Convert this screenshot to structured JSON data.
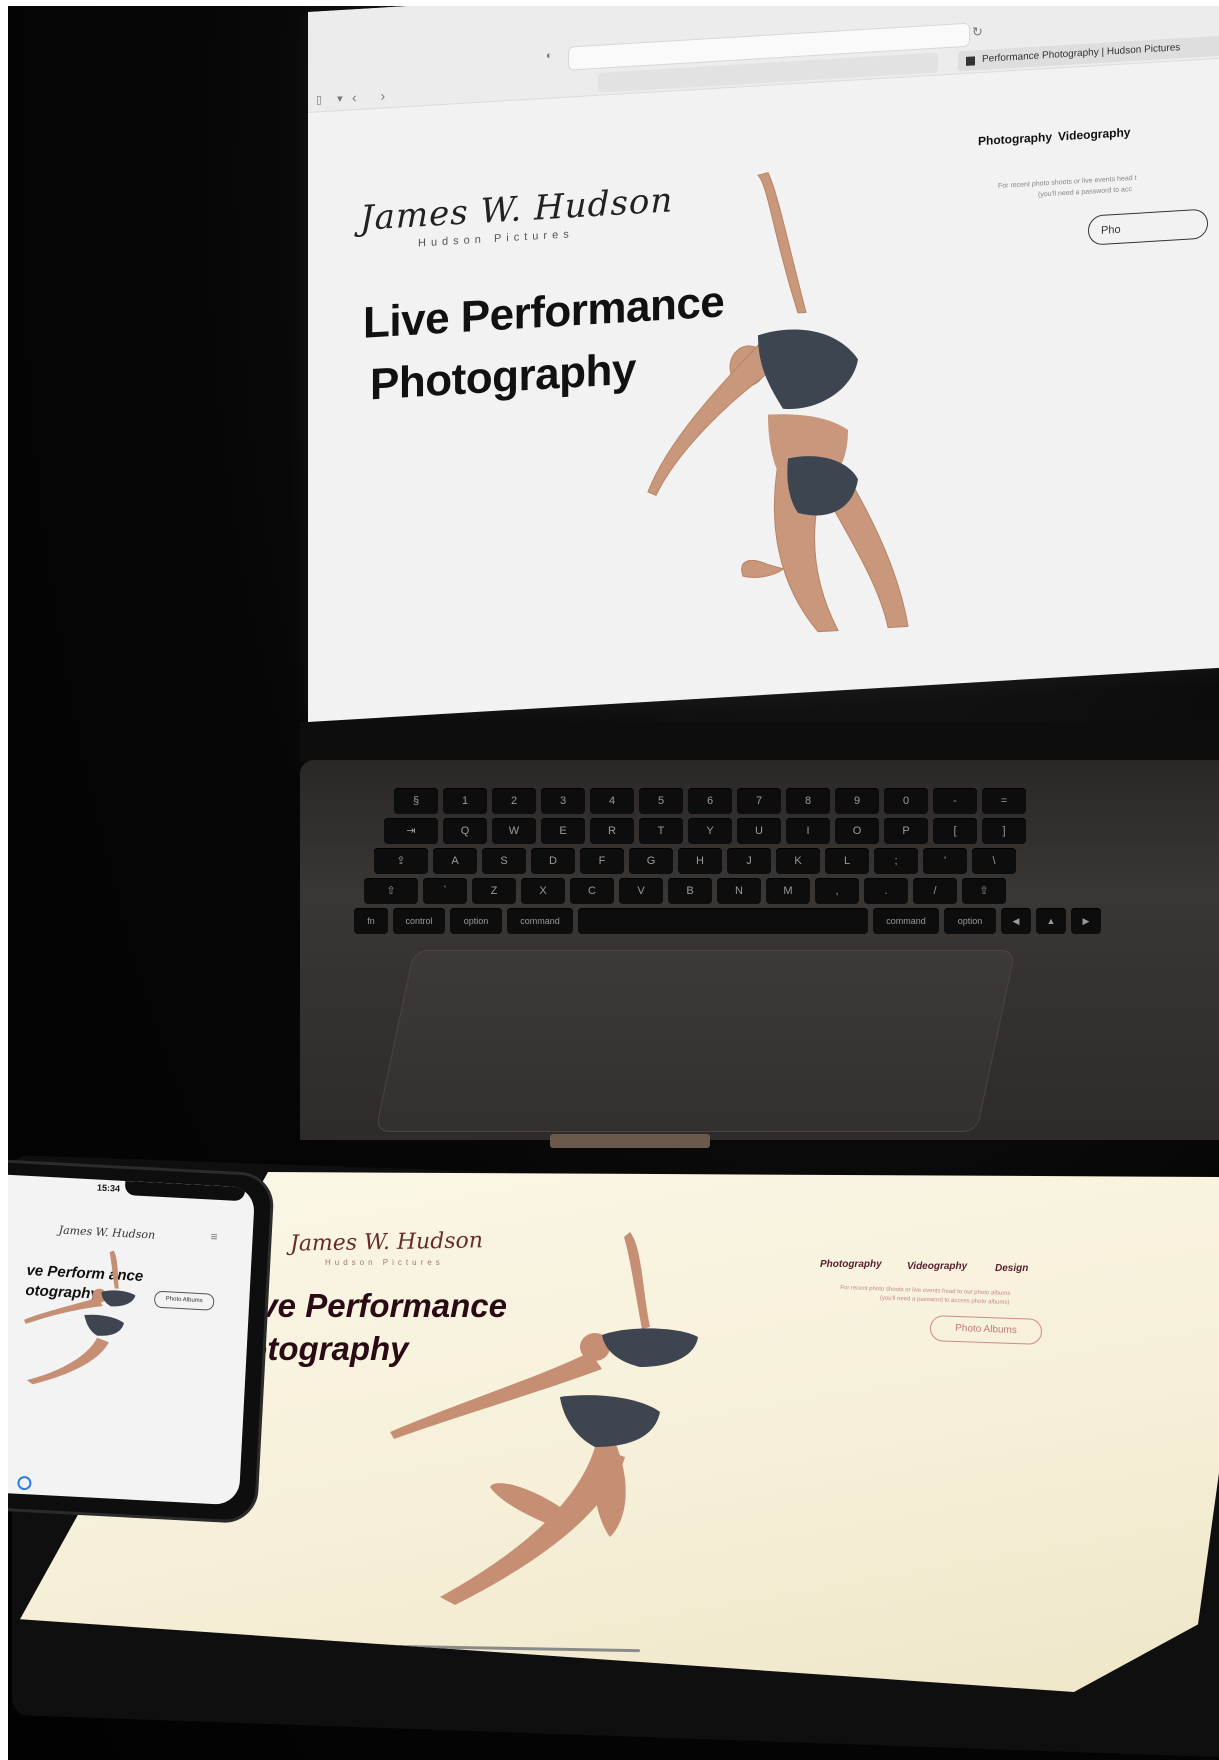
{
  "laptop": {
    "tab_title": "Performance Photography | Hudson Pictures",
    "logo": "James W. Hudson",
    "logo_sub": "Hudson Pictures",
    "nav": [
      "Photography",
      "Videography"
    ],
    "note_line1": "For recent photo shoots or live events head t",
    "note_line2": "(you'll need a password to acc",
    "cta": "Pho",
    "title_line1": "Live Performance",
    "title_line2": "Photography"
  },
  "keyboard": {
    "rows": [
      [
        "§",
        "1",
        "2",
        "3",
        "4",
        "5",
        "6",
        "7",
        "8",
        "9",
        "0",
        "-",
        "="
      ],
      [
        "⇥",
        "Q",
        "W",
        "E",
        "R",
        "T",
        "Y",
        "U",
        "I",
        "O",
        "P",
        "[",
        "]"
      ],
      [
        "⇪",
        "A",
        "S",
        "D",
        "F",
        "G",
        "H",
        "J",
        "K",
        "L",
        ";",
        "'",
        "\\"
      ],
      [
        "⇧",
        "`",
        "Z",
        "X",
        "C",
        "V",
        "B",
        "N",
        "M",
        ",",
        ".",
        "/",
        "⇧"
      ],
      [
        "fn",
        "control",
        "option",
        "command",
        "",
        "command",
        "option",
        "◀",
        "▲",
        "▶"
      ]
    ]
  },
  "phone": {
    "time": "15:34",
    "logo": "James W. Hudson",
    "title_line1": "ve Perform ance",
    "title_line2": "otography",
    "cta": "Photo Albums"
  },
  "tablet": {
    "logo": "James W. Hudson",
    "logo_sub": "Hudson Pictures",
    "nav": [
      "Photography",
      "Videography",
      "Design"
    ],
    "note_line1": "For recent photo shoots or live events head to our photo albums",
    "note_line2": "(you'll need a password to access photo albums)",
    "cta": "Photo Albums",
    "title_line1": "Live Performance",
    "title_line2": "Photography"
  }
}
